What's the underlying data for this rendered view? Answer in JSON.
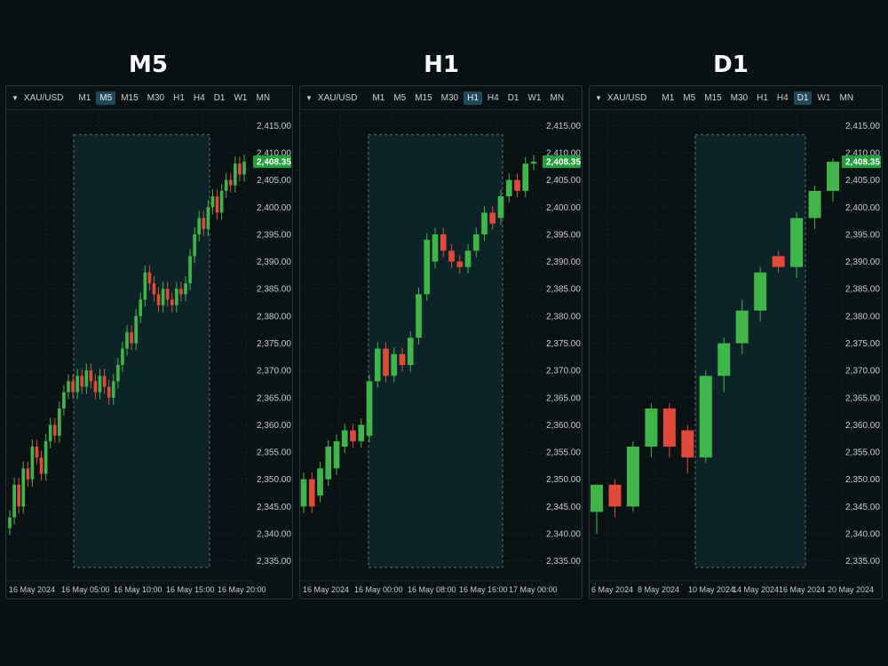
{
  "colors": {
    "up": "#3fb54a",
    "down": "#e04a3a",
    "tag": "#23a13c",
    "highlight_fill": "#0e2a2e",
    "highlight_border": "#5c7478"
  },
  "timeframes": [
    "M1",
    "M5",
    "M15",
    "M30",
    "H1",
    "H4",
    "D1",
    "W1",
    "MN"
  ],
  "y_ticks": [
    "2,415.00",
    "2,410.00",
    "2,405.00",
    "2,400.00",
    "2,395.00",
    "2,390.00",
    "2,385.00",
    "2,380.00",
    "2,375.00",
    "2,370.00",
    "2,365.00",
    "2,360.00",
    "2,355.00",
    "2,350.00",
    "2,345.00",
    "2,340.00",
    "2,335.00"
  ],
  "chart_data": [
    {
      "type": "candlestick",
      "title": "M5",
      "symbol": "XAU/USD",
      "active_timeframe": "M5",
      "last_price": "2,408.35",
      "ylim": [
        2332,
        2418
      ],
      "x_labels": [
        "16 May 2024",
        "16 May 05:00",
        "16 May 10:00",
        "16 May 15:00",
        "16 May 20:00"
      ],
      "closes": [
        2343,
        2349,
        2345,
        2352,
        2350,
        2356,
        2354,
        2351,
        2357,
        2360,
        2358,
        2363,
        2366,
        2368,
        2366,
        2369,
        2367,
        2370,
        2368,
        2366,
        2369,
        2367,
        2365,
        2368,
        2371,
        2374,
        2377,
        2375,
        2380,
        2383,
        2388,
        2386,
        2384,
        2382,
        2385,
        2383,
        2382,
        2385,
        2384,
        2386,
        2391,
        2395,
        2398,
        2396,
        2400,
        2402,
        2399,
        2403,
        2405,
        2404,
        2408,
        2406,
        2408.35
      ]
    },
    {
      "type": "candlestick",
      "title": "H1",
      "symbol": "XAU/USD",
      "active_timeframe": "H1",
      "last_price": "2,408.35",
      "ylim": [
        2332,
        2418
      ],
      "x_labels": [
        "16 May 2024",
        "16 May 00:00",
        "16 May 08:00",
        "16 May 16:00",
        "17 May 00:00"
      ],
      "candles": [
        {
          "o": 2345,
          "c": 2350
        },
        {
          "o": 2350,
          "c": 2345
        },
        {
          "o": 2347,
          "c": 2352
        },
        {
          "o": 2350,
          "c": 2356
        },
        {
          "o": 2352,
          "c": 2357
        },
        {
          "o": 2356,
          "c": 2359
        },
        {
          "o": 2359,
          "c": 2357
        },
        {
          "o": 2357,
          "c": 2360
        },
        {
          "o": 2358,
          "c": 2368
        },
        {
          "o": 2368,
          "c": 2374
        },
        {
          "o": 2374,
          "c": 2369
        },
        {
          "o": 2369,
          "c": 2373
        },
        {
          "o": 2373,
          "c": 2371
        },
        {
          "o": 2371,
          "c": 2376
        },
        {
          "o": 2376,
          "c": 2384
        },
        {
          "o": 2384,
          "c": 2394
        },
        {
          "o": 2390,
          "c": 2395
        },
        {
          "o": 2395,
          "c": 2392
        },
        {
          "o": 2392,
          "c": 2390
        },
        {
          "o": 2390,
          "c": 2389
        },
        {
          "o": 2389,
          "c": 2392
        },
        {
          "o": 2392,
          "c": 2395
        },
        {
          "o": 2395,
          "c": 2399
        },
        {
          "o": 2399,
          "c": 2397
        },
        {
          "o": 2398,
          "c": 2402
        },
        {
          "o": 2402,
          "c": 2405
        },
        {
          "o": 2405,
          "c": 2403
        },
        {
          "o": 2403,
          "c": 2408
        },
        {
          "o": 2408,
          "c": 2408.35
        }
      ]
    },
    {
      "type": "candlestick",
      "title": "D1",
      "symbol": "XAU/USD",
      "active_timeframe": "D1",
      "last_price": "2,408.35",
      "ylim": [
        2332,
        2418
      ],
      "x_labels": [
        "6 May 2024",
        "8 May 2024",
        "10 May 2024",
        "14 May 2024",
        "16 May 2024",
        "20 May 2024"
      ],
      "candles": [
        {
          "o": 2344,
          "h": 2349,
          "l": 2340,
          "c": 2349
        },
        {
          "o": 2349,
          "h": 2350,
          "l": 2343,
          "c": 2345
        },
        {
          "o": 2345,
          "h": 2357,
          "l": 2344,
          "c": 2356
        },
        {
          "o": 2356,
          "h": 2364,
          "l": 2354,
          "c": 2363
        },
        {
          "o": 2363,
          "h": 2364,
          "l": 2354,
          "c": 2356
        },
        {
          "o": 2359,
          "h": 2360,
          "l": 2351,
          "c": 2354
        },
        {
          "o": 2354,
          "h": 2370,
          "l": 2353,
          "c": 2369
        },
        {
          "o": 2369,
          "h": 2376,
          "l": 2366,
          "c": 2375
        },
        {
          "o": 2375,
          "h": 2383,
          "l": 2373,
          "c": 2381
        },
        {
          "o": 2381,
          "h": 2389,
          "l": 2379,
          "c": 2388
        },
        {
          "o": 2391,
          "h": 2392,
          "l": 2388,
          "c": 2389
        },
        {
          "o": 2389,
          "h": 2399,
          "l": 2387,
          "c": 2398
        },
        {
          "o": 2398,
          "h": 2404,
          "l": 2396,
          "c": 2403
        },
        {
          "o": 2403,
          "h": 2409,
          "l": 2401,
          "c": 2408.35
        }
      ]
    }
  ]
}
